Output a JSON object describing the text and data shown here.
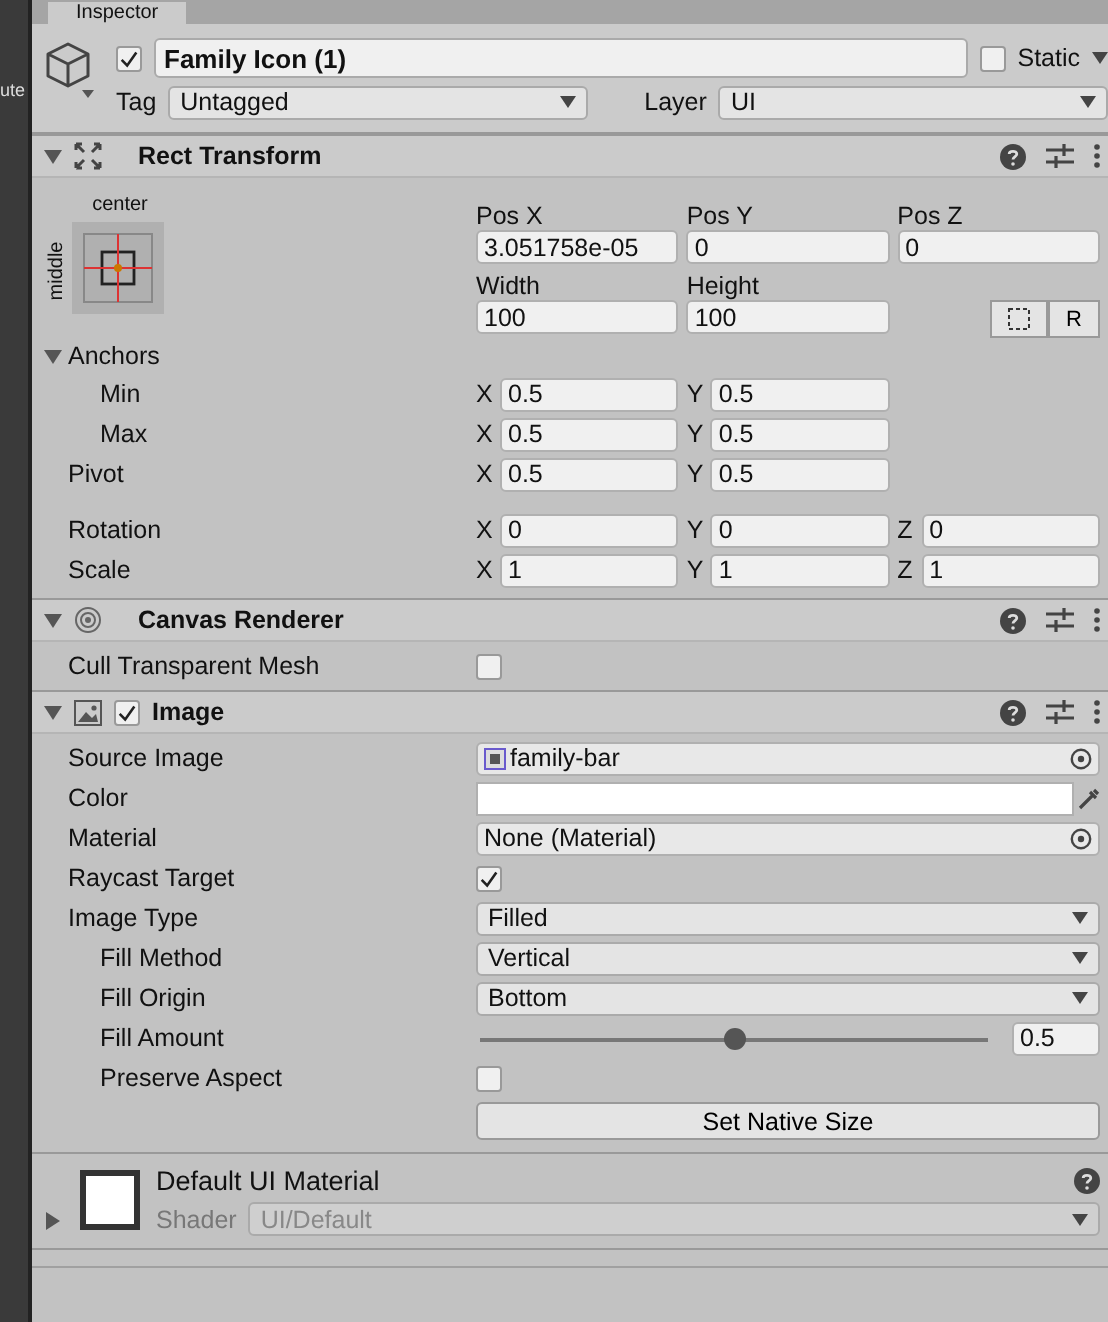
{
  "left_panel_fragment": "ute",
  "tab": {
    "title": "Inspector"
  },
  "object": {
    "active": true,
    "name": "Family Icon (1)",
    "static": false,
    "static_label": "Static",
    "tag_label": "Tag",
    "tag": "Untagged",
    "layer_label": "Layer",
    "layer": "UI"
  },
  "components": [
    {
      "kind": "rect_transform",
      "title": "Rect Transform",
      "expanded": true,
      "anchor_preset": {
        "top": "center",
        "side": "middle"
      },
      "position_fields": [
        {
          "label": "Pos X",
          "value": "3.051758e-05"
        },
        {
          "label": "Pos Y",
          "value": "0"
        },
        {
          "label": "Pos Z",
          "value": "0"
        }
      ],
      "size_fields": [
        {
          "label": "Width",
          "value": "100"
        },
        {
          "label": "Height",
          "value": "100"
        }
      ],
      "raw_button": "R",
      "anchors": {
        "label": "Anchors",
        "expanded": true,
        "rows": [
          {
            "label": "Min",
            "fields": [
              {
                "axis": "X",
                "value": "0.5"
              },
              {
                "axis": "Y",
                "value": "0.5"
              }
            ]
          },
          {
            "label": "Max",
            "fields": [
              {
                "axis": "X",
                "value": "0.5"
              },
              {
                "axis": "Y",
                "value": "0.5"
              }
            ]
          }
        ]
      },
      "rows": [
        {
          "label": "Pivot",
          "fields": [
            {
              "axis": "X",
              "value": "0.5"
            },
            {
              "axis": "Y",
              "value": "0.5"
            }
          ]
        },
        {
          "label": "Rotation",
          "fields": [
            {
              "axis": "X",
              "value": "0"
            },
            {
              "axis": "Y",
              "value": "0"
            },
            {
              "axis": "Z",
              "value": "0"
            }
          ]
        },
        {
          "label": "Scale",
          "fields": [
            {
              "axis": "X",
              "value": "1"
            },
            {
              "axis": "Y",
              "value": "1"
            },
            {
              "axis": "Z",
              "value": "1"
            }
          ]
        }
      ]
    },
    {
      "kind": "canvas_renderer",
      "title": "Canvas Renderer",
      "expanded": true,
      "properties": [
        {
          "kind": "checkbox",
          "label": "Cull Transparent Mesh",
          "checked": false,
          "indent": false
        }
      ]
    },
    {
      "kind": "image",
      "title": "Image",
      "expanded": true,
      "enabled": true,
      "properties": [
        {
          "kind": "sprite",
          "label": "Source Image",
          "value": "family-bar",
          "indent": false
        },
        {
          "kind": "color",
          "label": "Color",
          "indent": false
        },
        {
          "kind": "object",
          "label": "Material",
          "value": "None (Material)",
          "indent": false
        },
        {
          "kind": "checkbox",
          "label": "Raycast Target",
          "checked": true,
          "indent": false
        },
        {
          "kind": "dropdown",
          "label": "Image Type",
          "value": "Filled",
          "indent": false
        },
        {
          "kind": "dropdown",
          "label": "Fill Method",
          "value": "Vertical",
          "indent": true
        },
        {
          "kind": "dropdown",
          "label": "Fill Origin",
          "value": "Bottom",
          "indent": true
        },
        {
          "kind": "slider",
          "label": "Fill Amount",
          "level": 0.5,
          "value": "0.5",
          "indent": true
        },
        {
          "kind": "checkbox",
          "label": "Preserve Aspect",
          "checked": false,
          "indent": true
        }
      ],
      "button": "Set Native Size"
    }
  ],
  "material": {
    "name": "Default UI Material",
    "shader_label": "Shader",
    "shader": "UI/Default",
    "expanded": false
  }
}
